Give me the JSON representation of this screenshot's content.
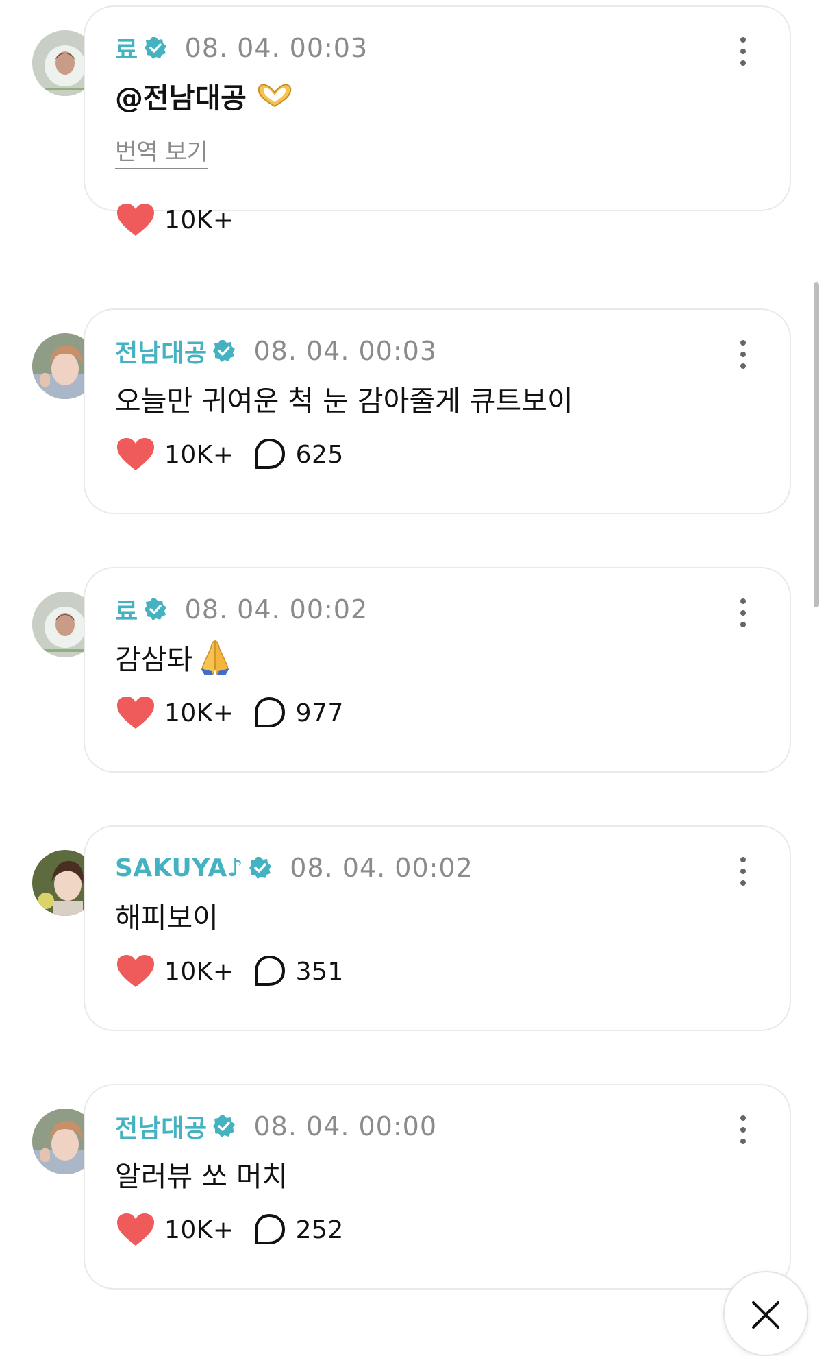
{
  "posts": [
    {
      "author": "료",
      "timestamp": "08. 04. 00:03",
      "mention": "@전남대공",
      "text": "",
      "emoji": "heart-hands",
      "translate_label": "번역 보기",
      "likes": "10K+",
      "comments": null
    },
    {
      "author": "전남대공",
      "timestamp": "08. 04. 00:03",
      "text": "오늘만 귀여운 척 눈 감아줄게 큐트보이",
      "likes": "10K+",
      "comments": "625"
    },
    {
      "author": "료",
      "timestamp": "08. 04. 00:02",
      "text": "감삼돠",
      "emoji": "folded-hands",
      "likes": "10K+",
      "comments": "977"
    },
    {
      "author": "SAKUYA♪",
      "timestamp": "08. 04. 00:02",
      "text": "해피보이",
      "likes": "10K+",
      "comments": "351"
    },
    {
      "author": "전남대공",
      "timestamp": "08. 04. 00:00",
      "text": "알러뷰 쏘 머치",
      "likes": "10K+",
      "comments": "252"
    }
  ],
  "icons": {
    "verified": "verified-badge-icon",
    "like": "heart-icon",
    "comment": "comment-bubble-icon",
    "more": "more-vertical-icon",
    "close": "close-icon"
  },
  "colors": {
    "author_name": "#44b2c1",
    "verified_badge": "#44b2c1",
    "heart": "#ef5a5a",
    "timestamp": "#8b8b8b"
  }
}
